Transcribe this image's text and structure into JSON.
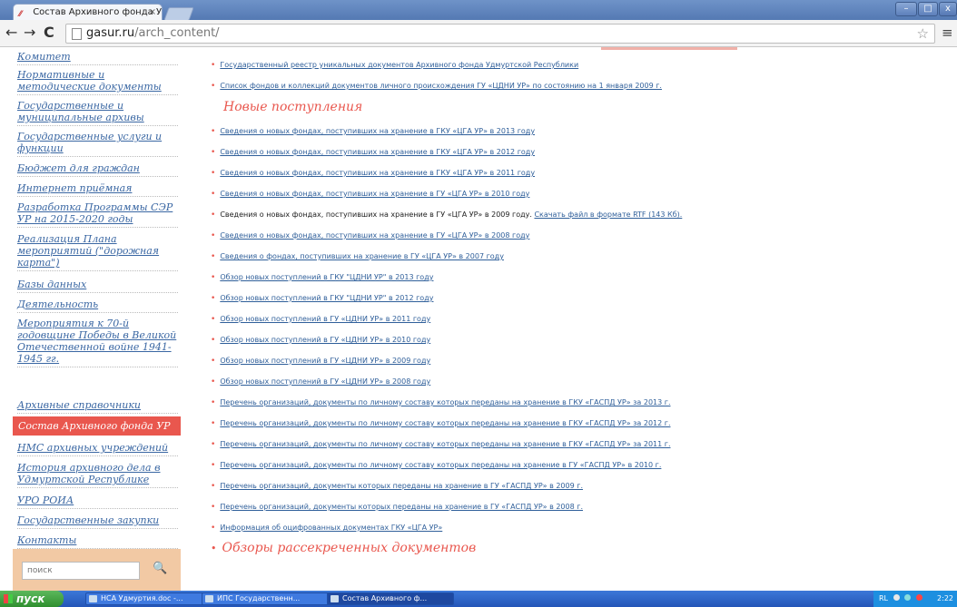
{
  "browser": {
    "tab_title": "Состав Архивного фонда У",
    "tab_close": "×",
    "url_domain": "gasur.ru",
    "url_path": "/arch_content/",
    "back": "←",
    "forward": "→",
    "reload": "C",
    "star": "☆",
    "menu": "≡",
    "win_min": "–",
    "win_max": "□",
    "win_close": "x"
  },
  "sidebar": {
    "items": [
      {
        "label": "Комитет"
      },
      {
        "label": "Нормативные и методические документы"
      },
      {
        "label": "Государственные и муниципальные архивы"
      },
      {
        "label": "Государственные услуги и функции"
      },
      {
        "label": "Бюджет для граждан"
      },
      {
        "label": "Интернет приёмная"
      },
      {
        "label": "Разработка Программы СЭР УР на 2015-2020 годы"
      },
      {
        "label": "Реализация Плана мероприятий (\"дорожная карта\")"
      },
      {
        "label": "Базы данных"
      },
      {
        "label": "Деятельность"
      },
      {
        "label": "Мероприятия к 70-й годовщине Победы в Великой Отечественной войне 1941-1945 гг."
      },
      {
        "label": "Архивные справочники"
      },
      {
        "label": "Состав Архивного фонда УР"
      },
      {
        "label": "НМС архивных учреждений"
      },
      {
        "label": "История архивного дела в Удмуртской Республике"
      },
      {
        "label": "УРО РОИА"
      },
      {
        "label": "Государственные закупки"
      },
      {
        "label": "Контакты"
      }
    ],
    "search_placeholder": "поиск",
    "search_icon": "🔍"
  },
  "main": {
    "top_links": [
      "Государственный реестр уникальных документов Архивного фонда Удмуртской Республики",
      "Список фондов и коллекций документов личного происхождения ГУ «ЦДНИ УР» по состоянию на 1 января 2009 г."
    ],
    "new_heading": "Новые поступления",
    "items": [
      {
        "text": "Сведения о новых фондах, поступивших на хранение в ГКУ «ЦГА УР» в 2013 году"
      },
      {
        "text": "Сведения о новых фондах, поступивших на хранение в ГКУ «ЦГА УР» в 2012 году"
      },
      {
        "text": "Сведения о новых фондах, поступивших на хранение в ГКУ «ЦГА УР» в 2011 году"
      },
      {
        "text": "Сведения о новых фондах, поступивших на хранение в ГУ «ЦГА УР» в 2010 году"
      },
      {
        "text": "Сведения о новых фондах, поступивших на хранение в ГУ «ЦГА УР» в 2009 году.",
        "extra": "Скачать файл в формате RTF (143 Кб)."
      },
      {
        "text": "Сведения о новых фондах, поступивших на хранение в ГУ «ЦГА УР» в 2008 году"
      },
      {
        "text": "Сведения о фондах, поступивших на хранение в ГУ «ЦГА УР» в 2007 году"
      },
      {
        "text": "Обзор новых поступлений в ГКУ \"ЦДНИ УР\" в 2013 году"
      },
      {
        "text": "Обзор новых поступлений в ГКУ \"ЦДНИ УР\" в 2012 году"
      },
      {
        "text": "Обзор новых поступлений в ГУ «ЦДНИ УР» в 2011 году"
      },
      {
        "text": "Обзор новых поступлений в ГУ «ЦДНИ УР» в 2010 году"
      },
      {
        "text": "Обзор новых поступлений в ГУ «ЦДНИ УР» в 2009 году"
      },
      {
        "text": "Обзор новых поступлений в ГУ «ЦДНИ УР» в 2008 году"
      },
      {
        "text": "Перечень организаций, документы по личному составу которых переданы на хранение в ГКУ «ГАСПД УР» за 2013 г."
      },
      {
        "text": "Перечень организаций, документы по личному составу которых переданы на хранение в ГКУ «ГАСПД УР» за 2012 г."
      },
      {
        "text": "Перечень организаций, документы по личному составу которых переданы на хранение в ГКУ «ГАСПД УР» за 2011 г."
      },
      {
        "text": "Перечень организаций, документы по личному составу которых переданы на хранение в ГУ «ГАСПД УР» в 2010 г."
      },
      {
        "text": "Перечень организаций, документы которых переданы на хранение в ГУ «ГАСПД УР» в 2009 г."
      },
      {
        "text": "Перечень организаций, документы которых переданы на хранение в ГУ «ГАСПД УР» в 2008 г."
      },
      {
        "text": "Информация об оцифрованных документах ГКУ «ЦГА УР»"
      }
    ],
    "reviews_heading": "Обзоры рассекреченных документов"
  },
  "taskbar": {
    "start": "пуск",
    "tasks": [
      {
        "label": "НСА Удмуртия.doc -..."
      },
      {
        "label": "ИПС Государственн..."
      },
      {
        "label": "Состав Архивного ф..."
      }
    ],
    "lang": "RL",
    "clock": "2:22"
  }
}
